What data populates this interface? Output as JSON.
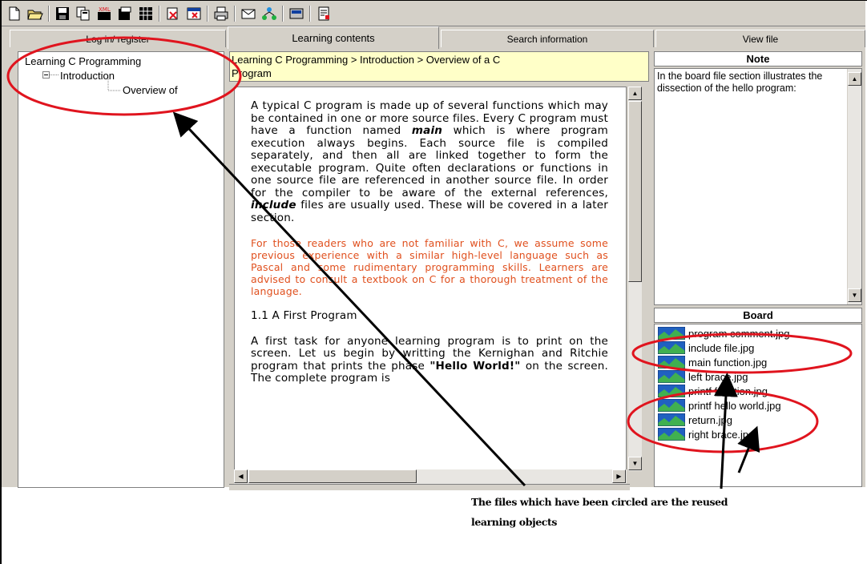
{
  "toolbar": {
    "buttons": [
      "new-document-icon",
      "open-folder-icon",
      "save-icon",
      "copy-icon",
      "xml-export-icon",
      "import-icon",
      "grid-icon",
      "edit-check-icon",
      "window-close-icon",
      "print-icon",
      "envelope-icon",
      "network-icon",
      "export-icon",
      "properties-icon"
    ]
  },
  "tabs": [
    {
      "label": "Log in/ register"
    },
    {
      "label": "Learning contents"
    },
    {
      "label": "Search information"
    },
    {
      "label": "View file"
    }
  ],
  "tree": {
    "root": "Learning C Programming",
    "child": "Introduction",
    "leaf": "Overview of"
  },
  "breadcrumb": {
    "line1": "Learning C Programming > Introduction > Overview of a C",
    "line2": "Program"
  },
  "content": {
    "para1_a": "A typical C program is made up of several functions which may be contained in one or more source files. Every C program must have a function named ",
    "para1_main": "main",
    "para1_b": " which is where program execution always begins. Each source file is compiled separately, and then all are linked together to form the executable program. Quite often declarations or functions in one source file are referenced in another source file. In order for the compiler to be aware of the external references, ",
    "para1_include": "include",
    "para1_c": " files are usually used. These will be covered in a later section.",
    "para2": "For those readers who are not familiar with C, we assume some previous experience with a similar high-level language such as Pascal and some rudimentary programming skills. Learners are advised to consult a textbook on C for a thorough treatment of the language.",
    "heading": "1.1 A First Program",
    "para3_a": "A first task for anyone learning program is to print on the screen. Let us begin by writting the Kernighan and Ritchie program that prints the phase ",
    "para3_hello": "\"Hello World!\"",
    "para3_b": " on the screen. The complete program is"
  },
  "note": {
    "header": "Note",
    "text": "In the board file section illustrates the dissection of the hello program:"
  },
  "board": {
    "header": "Board",
    "files": [
      "program comment.jpg",
      "include file.jpg",
      "main function.jpg",
      "left brace.jpg",
      "printf function.jpg",
      "printf hello world.jpg",
      "return.jpg",
      "right brace.jpg"
    ]
  },
  "caption": {
    "line1": "The files which have been circled are the reused",
    "line2": "learning objects"
  },
  "colors": {
    "annotation_red": "#e0141e",
    "orange_text": "#e0501e",
    "breadcrumb_bg": "#ffffc8",
    "window_gray": "#d4d0c8"
  }
}
